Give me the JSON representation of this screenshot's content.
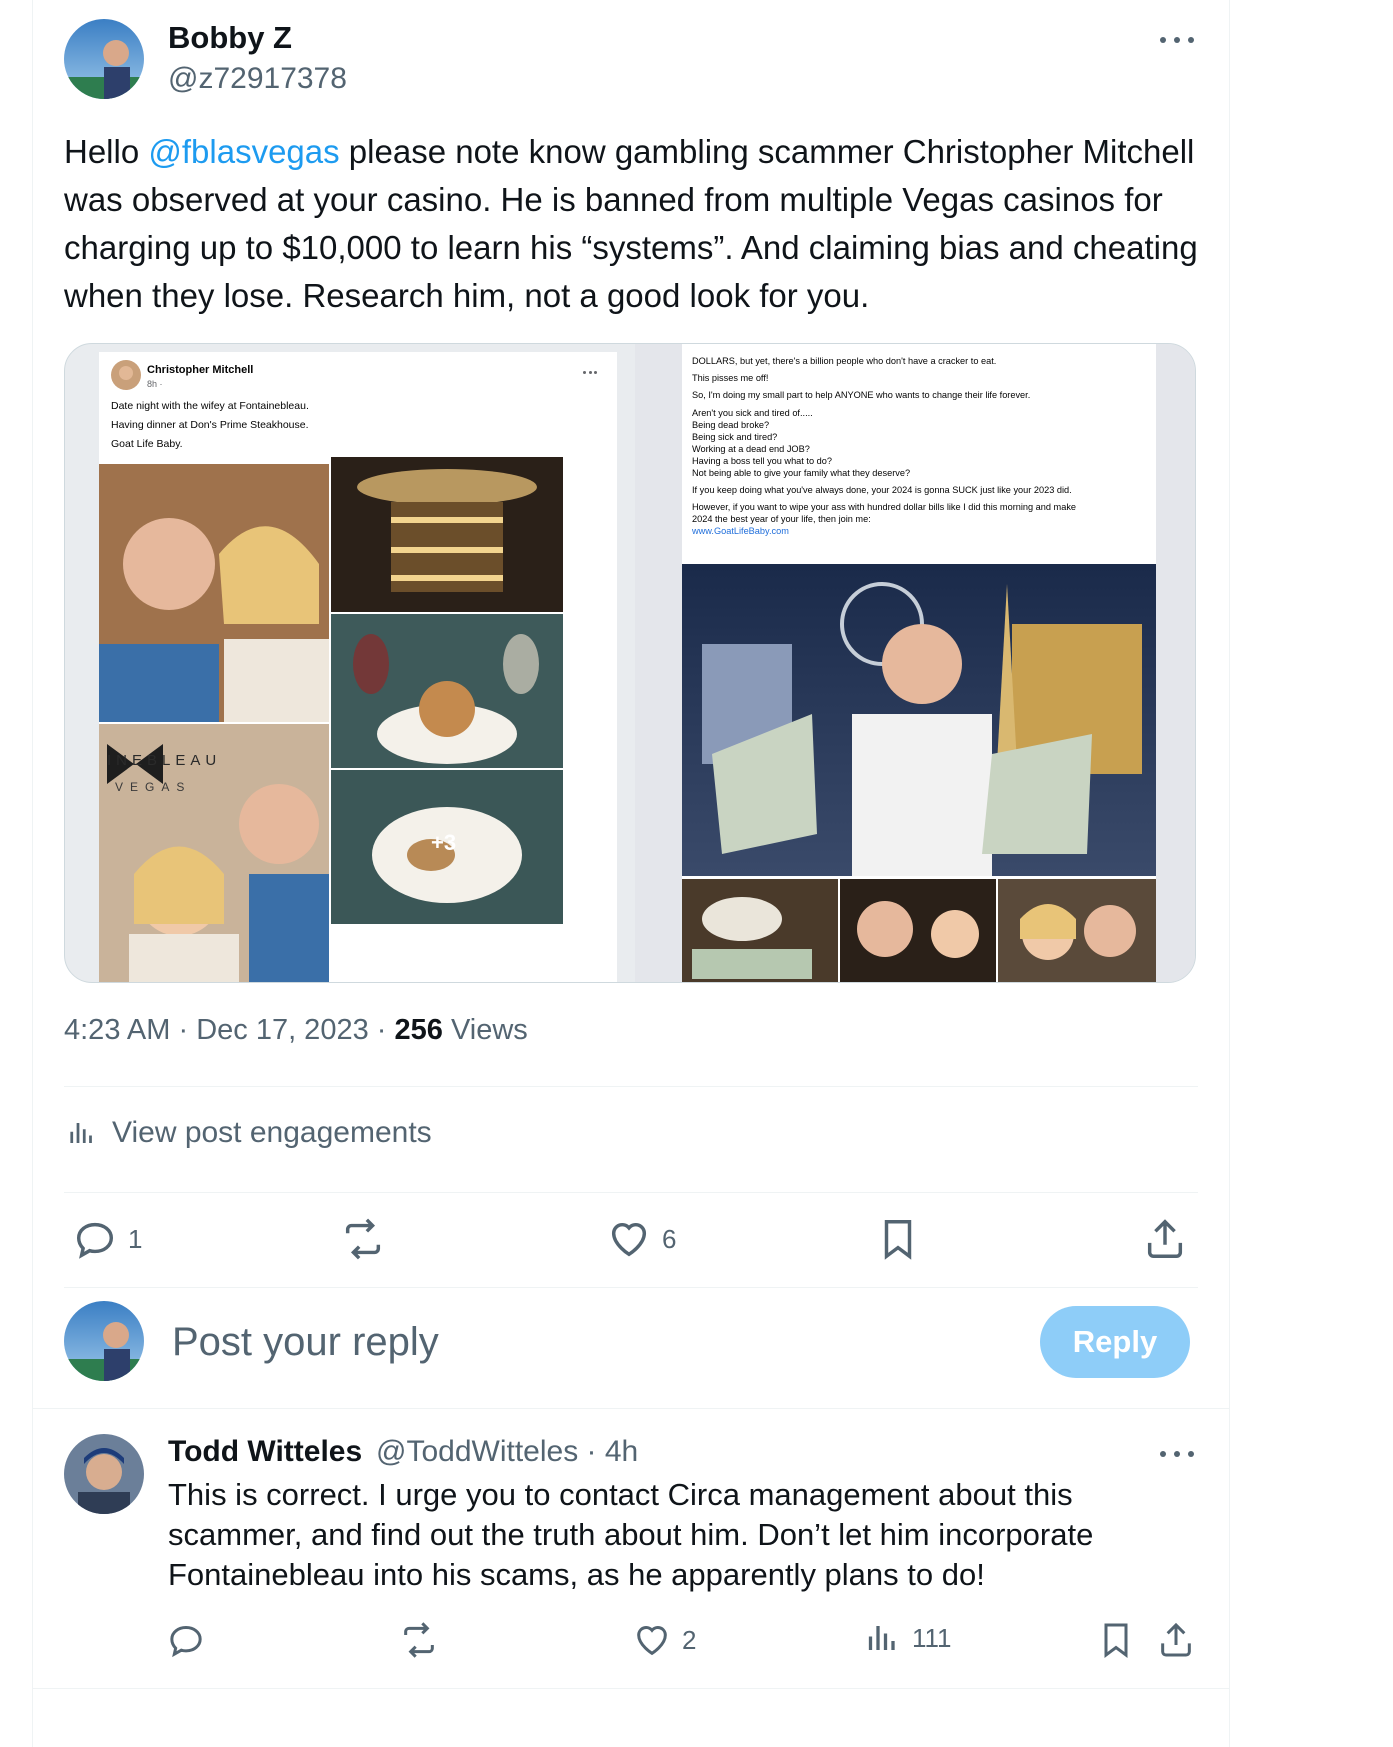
{
  "post": {
    "author_name": "Bobby Z",
    "author_handle": "@z72917378",
    "text_prefix": "Hello ",
    "mention": "@fblasvegas",
    "text_suffix": " please note know gambling scammer Christopher Mitchell was observed at your casino. He is banned from multiple Vegas casinos for charging up to $10,000 to learn his “systems”. And claiming bias and cheating when they lose. Research him, not a good look for you.",
    "time": "4:23 AM",
    "date": "Dec 17, 2023",
    "views_count": "256",
    "views_label": "Views",
    "engagements_label": "View post engagements",
    "reply_count": "1",
    "like_count": "6"
  },
  "media": {
    "left_card": {
      "author": "Christopher Mitchell",
      "time": "8h ·",
      "lines": [
        "Date night with the wifey at Fontainebleau.",
        "Having dinner at Don's Prime Steakhouse.",
        "Goat Life Baby."
      ],
      "logo_text_1": "INEBLEAU",
      "logo_text_2": "VEGAS",
      "more_photos": "+3"
    },
    "right_card": {
      "lines": [
        "DOLLARS, but yet, there's a billion people who don't have a cracker to eat.",
        "This pisses me off!",
        "So, I'm doing my small part to help ANYONE who wants to change their life forever.",
        "Aren't you sick and tired of.....",
        "Being dead broke?",
        "Being sick and tired?",
        "Working at a dead end JOB?",
        "Having a boss tell you what to do?",
        "Not being able to give your family what they deserve?",
        "If you keep doing what you've always done, your 2024 is gonna SUCK just like your 2023 did.",
        "However, if you want to wipe your ass with hundred dollar bills like I did this morning and make",
        "2024 the best year of your life, then join me:"
      ],
      "link": "www.GoatLifeBaby.com"
    }
  },
  "reply_box": {
    "placeholder": "Post your reply",
    "button_label": "Reply"
  },
  "reply": {
    "author_name": "Todd Witteles",
    "author_handle": "@ToddWitteles",
    "age": "· 4h",
    "text": "This is correct.  I urge you to contact Circa management about this scammer, and find out the truth about him.  Don’t let him incorporate Fontainebleau into his scams, as he apparently plans to do!",
    "like_count": "2",
    "view_count": "111"
  },
  "colors": {
    "accent": "#1d9bf0",
    "reply_button": "#8ecdf8",
    "secondary_text": "#536471"
  }
}
